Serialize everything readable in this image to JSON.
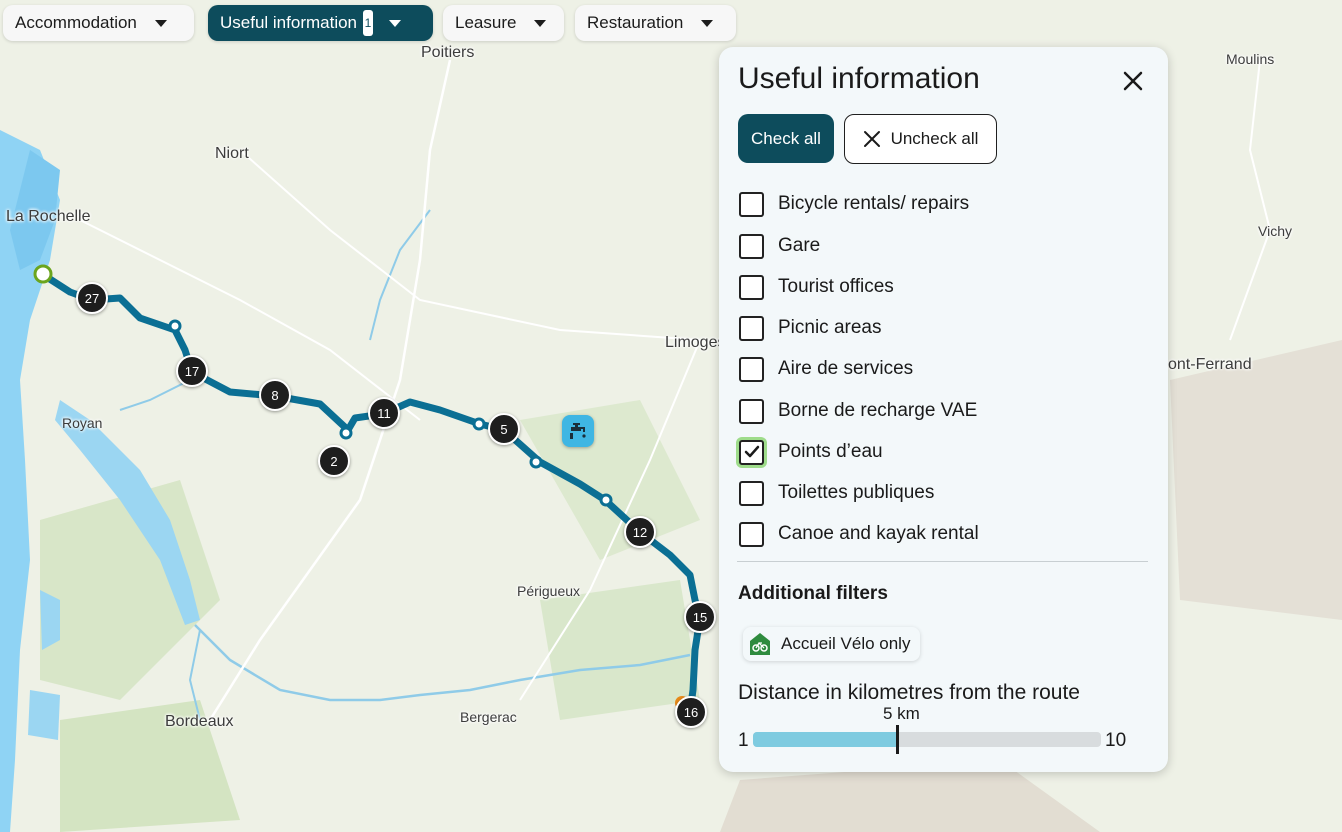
{
  "filters": [
    {
      "label": "Accommodation",
      "active": false,
      "count": ""
    },
    {
      "label": "Useful information",
      "active": true,
      "count": "1"
    },
    {
      "label": "Leasure",
      "active": false,
      "count": ""
    },
    {
      "label": "Restauration",
      "active": false,
      "count": ""
    }
  ],
  "map": {
    "cities": [
      {
        "name": "Poitiers"
      },
      {
        "name": "Niort"
      },
      {
        "name": "La Rochelle"
      },
      {
        "name": "Royan"
      },
      {
        "name": "Limoges"
      },
      {
        "name": "Périgueux"
      },
      {
        "name": "Bergerac"
      },
      {
        "name": "Bordeaux"
      },
      {
        "name": "Moulins"
      },
      {
        "name": "Vichy"
      },
      {
        "name": "ont-Ferrand"
      }
    ],
    "markers": [
      "27",
      "17",
      "8",
      "2",
      "11",
      "5",
      "12",
      "15",
      "16"
    ],
    "poi_icon": "water-tap-icon",
    "route_color": "#0b6f94"
  },
  "panel": {
    "title": "Useful information",
    "check_all": "Check all",
    "uncheck_all": "Uncheck all",
    "options": [
      {
        "label": "Bicycle rentals/ repairs",
        "checked": false
      },
      {
        "label": "Gare",
        "checked": false
      },
      {
        "label": "Tourist offices",
        "checked": false
      },
      {
        "label": "Picnic areas",
        "checked": false
      },
      {
        "label": "Aire de services",
        "checked": false
      },
      {
        "label": "Borne de recharge VAE",
        "checked": false
      },
      {
        "label": "Points d’eau",
        "checked": true
      },
      {
        "label": "Toilettes publiques",
        "checked": false
      },
      {
        "label": "Canoe and kayak rental",
        "checked": false
      }
    ],
    "additional_filters_title": "Additional filters",
    "accueil_velo": "Accueil Vélo only",
    "distance_title": "Distance in kilometres from the route",
    "distance_value": "5 km",
    "slider_min": "1",
    "slider_max": "10",
    "slider_current": 5
  },
  "colors": {
    "accent": "#0d4c5c",
    "check_highlight": "#9edc8a",
    "slider_fill": "#7ecbe0"
  }
}
